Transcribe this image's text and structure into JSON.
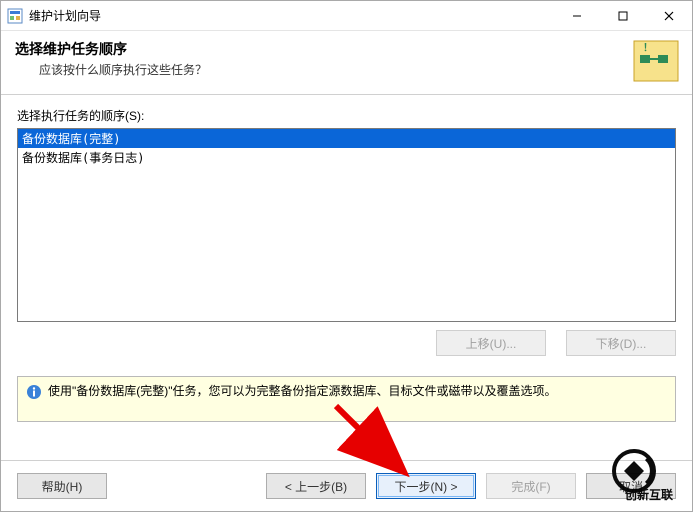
{
  "window": {
    "title": "维护计划向导"
  },
  "header": {
    "heading": "选择维护任务顺序",
    "sub": "应该按什么顺序执行这些任务？"
  },
  "body": {
    "order_label": "选择执行任务的顺序(S):",
    "list_items": [
      "备份数据库(完整)",
      "备份数据库(事务日志)"
    ],
    "selected_index": 0,
    "move_up": "上移(U)...",
    "move_down": "下移(D)..."
  },
  "info": {
    "text": "使用\"备份数据库(完整)\"任务，您可以为完整备份指定源数据库、目标文件或磁带以及覆盖选项。"
  },
  "footer": {
    "help": "帮助(H)",
    "back": "< 上一步(B)",
    "next": "下一步(N) >",
    "finish": "完成(F)",
    "cancel": "取消"
  },
  "watermark": "创新互联"
}
